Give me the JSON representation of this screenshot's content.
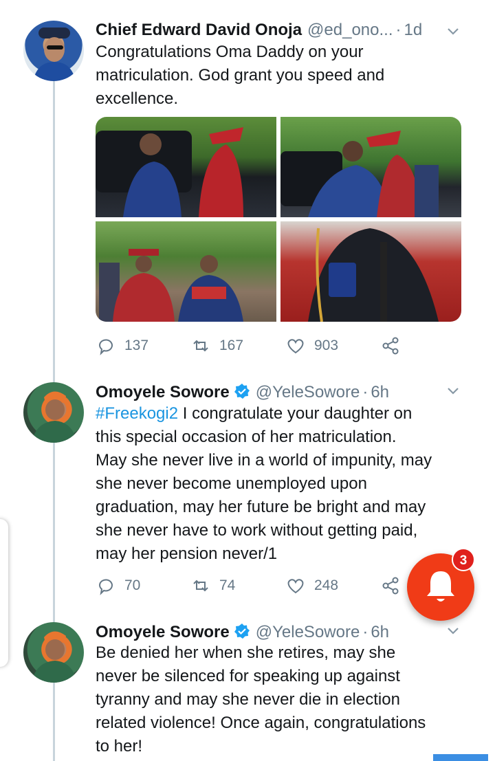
{
  "tweets": [
    {
      "name": "Chief Edward David Onoja",
      "handle": "@ed_ono...",
      "separator": "·",
      "time": "1d",
      "verified": false,
      "text": "Congratulations Oma Daddy on your\nmatriculation. God grant you speed and\nexcellence.",
      "has_media": true,
      "stats": {
        "replies": "137",
        "retweets": "167",
        "likes": "903"
      }
    },
    {
      "name": "Omoyele Sowore",
      "handle": "@YeleSowore",
      "separator": "·",
      "time": "6h",
      "verified": true,
      "hashtag": "#Freekogi2",
      "text": " I congratulate your daughter on\nthis special occasion of her matriculation.\nMay she never live in a world of impunity, may\nshe never become unemployed upon\ngraduation, may her future be bright and may\nshe never have to work without getting paid,\nmay her pension never/1",
      "stats": {
        "replies": "70",
        "retweets": "74",
        "likes": "248"
      }
    },
    {
      "name": "Omoyele Sowore",
      "handle": "@YeleSowore",
      "separator": "·",
      "time": "6h",
      "verified": true,
      "text": "Be denied her when she retires, may she\nnever be silenced for speaking up against\ntyranny and may she never die in election\nrelated violence! Once again, congratulations\nto her!"
    }
  ],
  "notification": {
    "icon": "bell-icon",
    "count": "3"
  },
  "colors": {
    "accent": "#1b95e0",
    "fab": "#f03b17",
    "badge": "#e0201c",
    "muted": "#657786"
  }
}
